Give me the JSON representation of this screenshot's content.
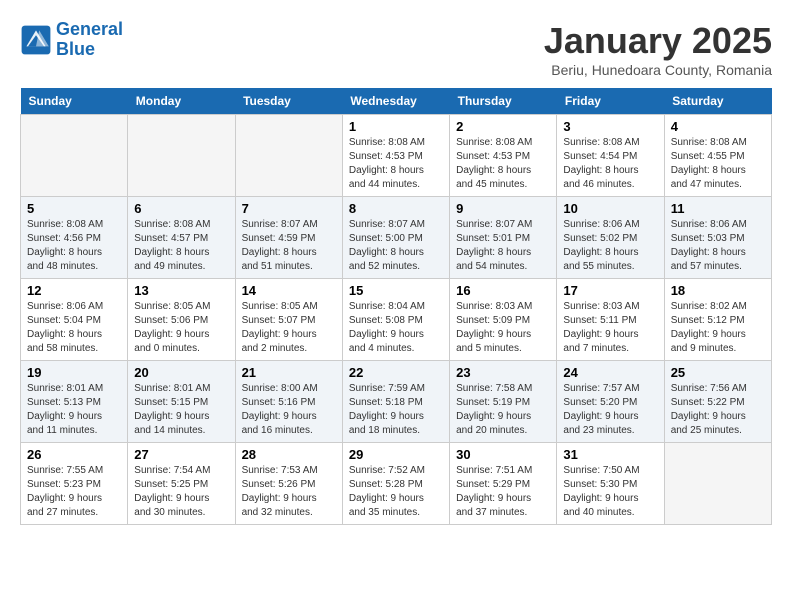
{
  "logo": {
    "line1": "General",
    "line2": "Blue"
  },
  "title": "January 2025",
  "subtitle": "Beriu, Hunedoara County, Romania",
  "weekdays": [
    "Sunday",
    "Monday",
    "Tuesday",
    "Wednesday",
    "Thursday",
    "Friday",
    "Saturday"
  ],
  "weeks": [
    [
      {
        "day": "",
        "info": ""
      },
      {
        "day": "",
        "info": ""
      },
      {
        "day": "",
        "info": ""
      },
      {
        "day": "1",
        "info": "Sunrise: 8:08 AM\nSunset: 4:53 PM\nDaylight: 8 hours\nand 44 minutes."
      },
      {
        "day": "2",
        "info": "Sunrise: 8:08 AM\nSunset: 4:53 PM\nDaylight: 8 hours\nand 45 minutes."
      },
      {
        "day": "3",
        "info": "Sunrise: 8:08 AM\nSunset: 4:54 PM\nDaylight: 8 hours\nand 46 minutes."
      },
      {
        "day": "4",
        "info": "Sunrise: 8:08 AM\nSunset: 4:55 PM\nDaylight: 8 hours\nand 47 minutes."
      }
    ],
    [
      {
        "day": "5",
        "info": "Sunrise: 8:08 AM\nSunset: 4:56 PM\nDaylight: 8 hours\nand 48 minutes."
      },
      {
        "day": "6",
        "info": "Sunrise: 8:08 AM\nSunset: 4:57 PM\nDaylight: 8 hours\nand 49 minutes."
      },
      {
        "day": "7",
        "info": "Sunrise: 8:07 AM\nSunset: 4:59 PM\nDaylight: 8 hours\nand 51 minutes."
      },
      {
        "day": "8",
        "info": "Sunrise: 8:07 AM\nSunset: 5:00 PM\nDaylight: 8 hours\nand 52 minutes."
      },
      {
        "day": "9",
        "info": "Sunrise: 8:07 AM\nSunset: 5:01 PM\nDaylight: 8 hours\nand 54 minutes."
      },
      {
        "day": "10",
        "info": "Sunrise: 8:06 AM\nSunset: 5:02 PM\nDaylight: 8 hours\nand 55 minutes."
      },
      {
        "day": "11",
        "info": "Sunrise: 8:06 AM\nSunset: 5:03 PM\nDaylight: 8 hours\nand 57 minutes."
      }
    ],
    [
      {
        "day": "12",
        "info": "Sunrise: 8:06 AM\nSunset: 5:04 PM\nDaylight: 8 hours\nand 58 minutes."
      },
      {
        "day": "13",
        "info": "Sunrise: 8:05 AM\nSunset: 5:06 PM\nDaylight: 9 hours\nand 0 minutes."
      },
      {
        "day": "14",
        "info": "Sunrise: 8:05 AM\nSunset: 5:07 PM\nDaylight: 9 hours\nand 2 minutes."
      },
      {
        "day": "15",
        "info": "Sunrise: 8:04 AM\nSunset: 5:08 PM\nDaylight: 9 hours\nand 4 minutes."
      },
      {
        "day": "16",
        "info": "Sunrise: 8:03 AM\nSunset: 5:09 PM\nDaylight: 9 hours\nand 5 minutes."
      },
      {
        "day": "17",
        "info": "Sunrise: 8:03 AM\nSunset: 5:11 PM\nDaylight: 9 hours\nand 7 minutes."
      },
      {
        "day": "18",
        "info": "Sunrise: 8:02 AM\nSunset: 5:12 PM\nDaylight: 9 hours\nand 9 minutes."
      }
    ],
    [
      {
        "day": "19",
        "info": "Sunrise: 8:01 AM\nSunset: 5:13 PM\nDaylight: 9 hours\nand 11 minutes."
      },
      {
        "day": "20",
        "info": "Sunrise: 8:01 AM\nSunset: 5:15 PM\nDaylight: 9 hours\nand 14 minutes."
      },
      {
        "day": "21",
        "info": "Sunrise: 8:00 AM\nSunset: 5:16 PM\nDaylight: 9 hours\nand 16 minutes."
      },
      {
        "day": "22",
        "info": "Sunrise: 7:59 AM\nSunset: 5:18 PM\nDaylight: 9 hours\nand 18 minutes."
      },
      {
        "day": "23",
        "info": "Sunrise: 7:58 AM\nSunset: 5:19 PM\nDaylight: 9 hours\nand 20 minutes."
      },
      {
        "day": "24",
        "info": "Sunrise: 7:57 AM\nSunset: 5:20 PM\nDaylight: 9 hours\nand 23 minutes."
      },
      {
        "day": "25",
        "info": "Sunrise: 7:56 AM\nSunset: 5:22 PM\nDaylight: 9 hours\nand 25 minutes."
      }
    ],
    [
      {
        "day": "26",
        "info": "Sunrise: 7:55 AM\nSunset: 5:23 PM\nDaylight: 9 hours\nand 27 minutes."
      },
      {
        "day": "27",
        "info": "Sunrise: 7:54 AM\nSunset: 5:25 PM\nDaylight: 9 hours\nand 30 minutes."
      },
      {
        "day": "28",
        "info": "Sunrise: 7:53 AM\nSunset: 5:26 PM\nDaylight: 9 hours\nand 32 minutes."
      },
      {
        "day": "29",
        "info": "Sunrise: 7:52 AM\nSunset: 5:28 PM\nDaylight: 9 hours\nand 35 minutes."
      },
      {
        "day": "30",
        "info": "Sunrise: 7:51 AM\nSunset: 5:29 PM\nDaylight: 9 hours\nand 37 minutes."
      },
      {
        "day": "31",
        "info": "Sunrise: 7:50 AM\nSunset: 5:30 PM\nDaylight: 9 hours\nand 40 minutes."
      },
      {
        "day": "",
        "info": ""
      }
    ]
  ]
}
